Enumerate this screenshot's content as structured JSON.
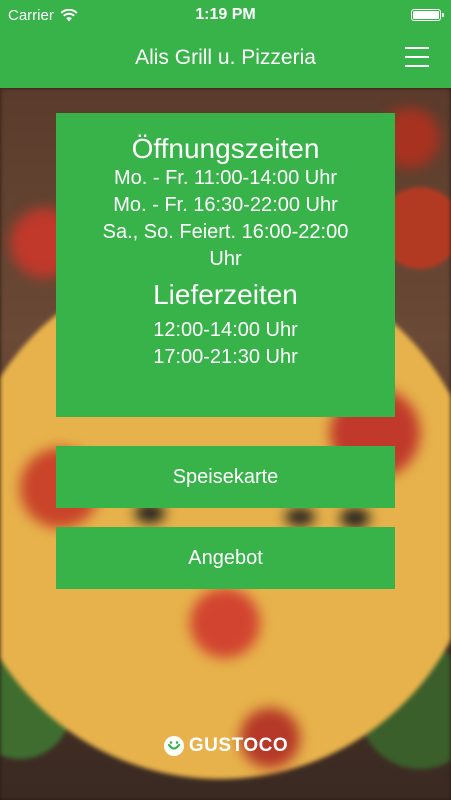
{
  "status_bar": {
    "carrier": "Carrier",
    "time": "1:19 PM"
  },
  "header": {
    "title": "Alis Grill u. Pizzeria",
    "menu_icon": "hamburger-menu-icon"
  },
  "hours": {
    "opening_title": "Öffnungszeiten",
    "opening_lines": [
      "Mo. - Fr. 11:00-14:00 Uhr",
      "Mo. - Fr. 16:30-22:00 Uhr",
      "Sa., So. Feiert. 16:00-22:00",
      "Uhr"
    ],
    "delivery_title": "Lieferzeiten",
    "delivery_lines": [
      "12:00-14:00 Uhr",
      "17:00-21:30 Uhr"
    ]
  },
  "buttons": {
    "menu_label": "Speisekarte",
    "offer_label": "Angebot"
  },
  "footer": {
    "brand": "GUSTOCO"
  },
  "colors": {
    "accent_green": "#37b34a",
    "text": "#ffffff"
  }
}
